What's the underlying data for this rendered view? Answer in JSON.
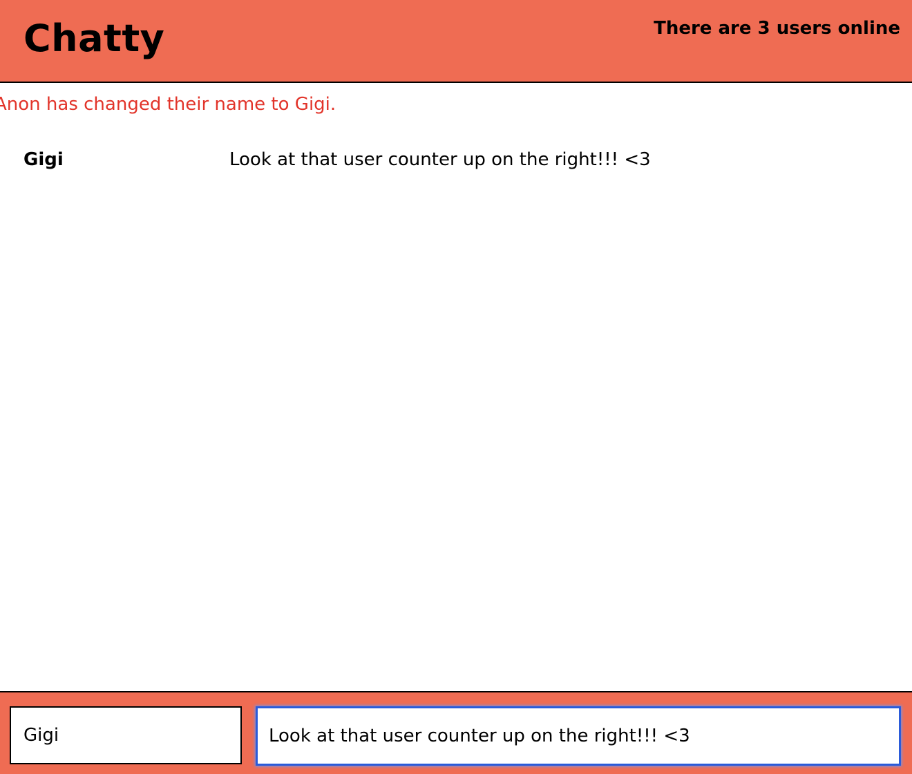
{
  "app": {
    "title": "Chatty",
    "user_count_text": "There are 3 users online"
  },
  "messages": {
    "notification": "Anon has changed their name to Gigi.",
    "items": [
      {
        "username": "Gigi",
        "content": "Look at that user counter up on the right!!! <3"
      }
    ]
  },
  "chatbar": {
    "username_value": "Gigi",
    "message_value": "Look at that user counter up on the right!!! <3"
  },
  "colors": {
    "accent": "#ef6c53",
    "notification": "#e2342a",
    "focus_ring": "#2b5bd9"
  }
}
